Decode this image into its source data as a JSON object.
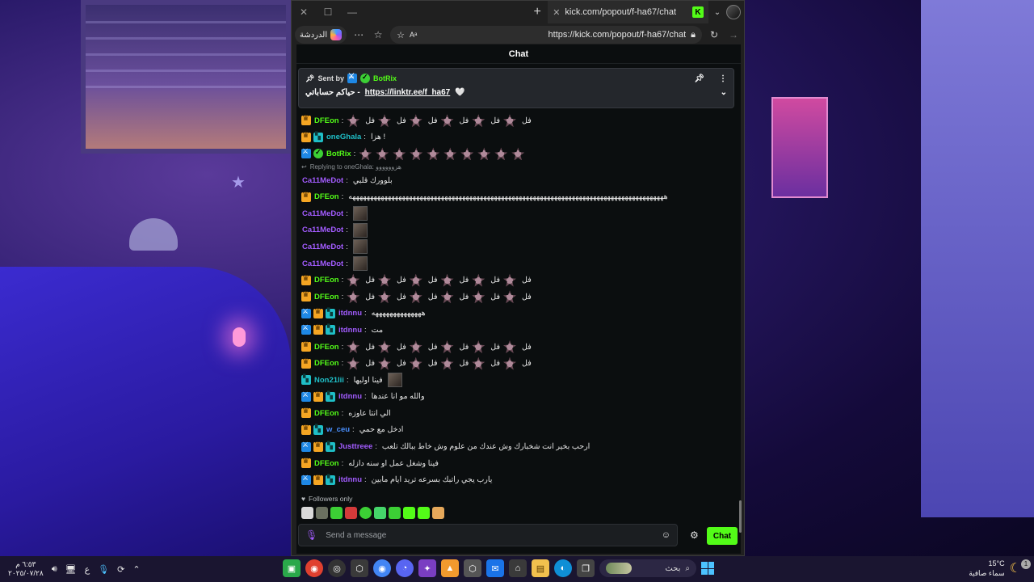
{
  "browser": {
    "tab_title": "kick.com/popout/f-ha67/chat",
    "url": "https://kick.com/popout/f-ha67/chat",
    "copilot_label": "الدردشة",
    "favicon_letter": "K"
  },
  "chat": {
    "header": "Chat",
    "pinned": {
      "sent_by_label": "Sent by",
      "author": "BotRix",
      "message_prefix": "حياكم حساباتي -",
      "link": "https://linktr.ee/f_ha67",
      "heart": "🤍"
    },
    "messages": [
      {
        "badges": [
          "crown"
        ],
        "name": "DFEon",
        "color": "#53fc18",
        "text": "فل",
        "emotes": 6,
        "kind": "emote-fal"
      },
      {
        "badges": [
          "crown",
          "sub"
        ],
        "name": "oneGhala",
        "color": "#1fbfc7",
        "text": "هزا !",
        "emotes": 0,
        "kind": "text"
      },
      {
        "badges": [
          "mod",
          "verified"
        ],
        "name": "BotRix",
        "color": "#53fc18",
        "text": "",
        "emotes": 10,
        "kind": "emotes"
      },
      {
        "reply": "Replying to oneGhala: هزوووووو",
        "badges": [],
        "name": "Ca11MeDot",
        "color": "#a35cff",
        "text": "بلوورك قلبي",
        "emotes": 0,
        "kind": "text"
      },
      {
        "badges": [
          "crown"
        ],
        "name": "DFEon",
        "color": "#53fc18",
        "text": "هههههههههههههههههههههههههههههههههههههههههههههههههههههههههههههههههههههههههههههههههههههههههه",
        "emotes": 0,
        "kind": "text"
      },
      {
        "badges": [],
        "name": "Ca11MeDot",
        "color": "#a35cff",
        "text": "",
        "emotes": 0,
        "kind": "thumb"
      },
      {
        "badges": [],
        "name": "Ca11MeDot",
        "color": "#a35cff",
        "text": "",
        "emotes": 0,
        "kind": "thumb"
      },
      {
        "badges": [],
        "name": "Ca11MeDot",
        "color": "#a35cff",
        "text": "",
        "emotes": 0,
        "kind": "thumb"
      },
      {
        "badges": [],
        "name": "Ca11MeDot",
        "color": "#a35cff",
        "text": "",
        "emotes": 0,
        "kind": "thumb"
      },
      {
        "badges": [
          "crown"
        ],
        "name": "DFEon",
        "color": "#53fc18",
        "text": "فل",
        "emotes": 6,
        "kind": "emote-fal"
      },
      {
        "badges": [
          "crown"
        ],
        "name": "DFEon",
        "color": "#53fc18",
        "text": "فل",
        "emotes": 6,
        "kind": "emote-fal"
      },
      {
        "badges": [
          "mod",
          "crown",
          "sub"
        ],
        "name": "itdnnu",
        "color": "#a35cff",
        "text": "ههههههههههههههه",
        "emotes": 0,
        "kind": "text"
      },
      {
        "badges": [
          "mod",
          "crown",
          "sub"
        ],
        "name": "itdnnu",
        "color": "#a35cff",
        "text": "مت",
        "emotes": 0,
        "kind": "text"
      },
      {
        "badges": [
          "crown"
        ],
        "name": "DFEon",
        "color": "#53fc18",
        "text": "فل",
        "emotes": 6,
        "kind": "emote-fal"
      },
      {
        "badges": [
          "crown"
        ],
        "name": "DFEon",
        "color": "#53fc18",
        "text": "فل",
        "emotes": 6,
        "kind": "emote-fal"
      },
      {
        "badges": [
          "sub"
        ],
        "name": "Non21lii",
        "color": "#1fbfc7",
        "text": "فينا اوليها",
        "emotes": 0,
        "kind": "text-thumb"
      },
      {
        "badges": [
          "mod",
          "crown",
          "sub"
        ],
        "name": "itdnnu",
        "color": "#a35cff",
        "text": "والله مو انا عندها",
        "emotes": 0,
        "kind": "text"
      },
      {
        "badges": [
          "crown"
        ],
        "name": "DFEon",
        "color": "#53fc18",
        "text": "الي انتا عاوزه",
        "emotes": 0,
        "kind": "text"
      },
      {
        "badges": [
          "crown",
          "sub"
        ],
        "name": "w_ceu",
        "color": "#4a90ff",
        "text": "ادخل مع حمي",
        "emotes": 0,
        "kind": "text"
      },
      {
        "badges": [
          "mod",
          "crown",
          "sub"
        ],
        "name": "Justtreee",
        "color": "#a35cff",
        "text": "ارحب بخير انت شخبارك وش عندك من علوم وش خاط ببالك تلعب",
        "emotes": 0,
        "kind": "text"
      },
      {
        "badges": [
          "crown"
        ],
        "name": "DFEon",
        "color": "#53fc18",
        "text": "فينا وشغل عمل او سنه دازله",
        "emotes": 0,
        "kind": "text"
      },
      {
        "badges": [
          "mod",
          "crown",
          "sub"
        ],
        "name": "itdnnu",
        "color": "#a35cff",
        "text": "يارب يجي راتبك بسرعه تريد ايام مابين",
        "emotes": 0,
        "kind": "text"
      }
    ],
    "followers_only": "Followers only",
    "input_placeholder": "Send a message",
    "send_label": "Chat"
  },
  "taskbar": {
    "time": "٦:٥٣ م",
    "date": "٢٠٢٥/٠٧/٢٨",
    "lang": "ع",
    "search_placeholder": "بحث",
    "weather_temp": "15°C",
    "weather_desc": "سماء صافية",
    "notifications": "1"
  },
  "colors": {
    "kick_green": "#53fc18",
    "chat_bg": "#0b0e0f",
    "accent_purple": "#a35cff"
  }
}
